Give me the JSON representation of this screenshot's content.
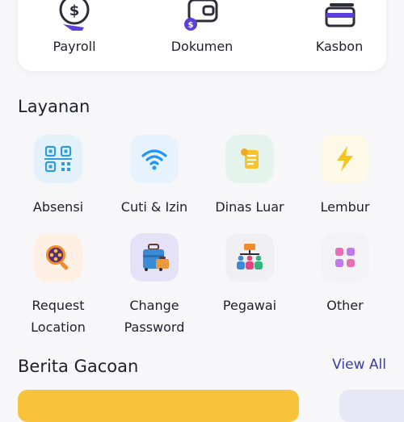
{
  "quick_menu": [
    {
      "label": "Payroll",
      "icon": "payroll-icon"
    },
    {
      "label": "Dokumen",
      "icon": "wallet-icon"
    },
    {
      "label": "Kasbon",
      "icon": "card-icon"
    }
  ],
  "services": {
    "title": "Layanan",
    "items": [
      {
        "label": "Absensi",
        "icon": "qr-code-icon",
        "bg": "#e3f1fb"
      },
      {
        "label": "Cuti & Izin",
        "icon": "wifi-icon",
        "bg": "#e6f2fd"
      },
      {
        "label": "Dinas Luar",
        "icon": "scroll-icon",
        "bg": "#e4f4ec"
      },
      {
        "label": "Lembur",
        "icon": "lightning-icon",
        "bg": "#fdf9e7"
      },
      {
        "label_line1": "Request",
        "label_line2": "Location",
        "icon": "film-search-icon",
        "bg": "#fdf0e3"
      },
      {
        "label_line1": "Change",
        "label_line2": "Password",
        "icon": "luggage-icon",
        "bg": "#e5e1f7"
      },
      {
        "label": "Pegawai",
        "icon": "team-icon",
        "bg": "#f0f0f2"
      },
      {
        "label": "Other",
        "icon": "grid-icon",
        "bg": "#f3f3f5"
      }
    ]
  },
  "news": {
    "title": "Berita Gacoan",
    "view_all": "View All"
  }
}
